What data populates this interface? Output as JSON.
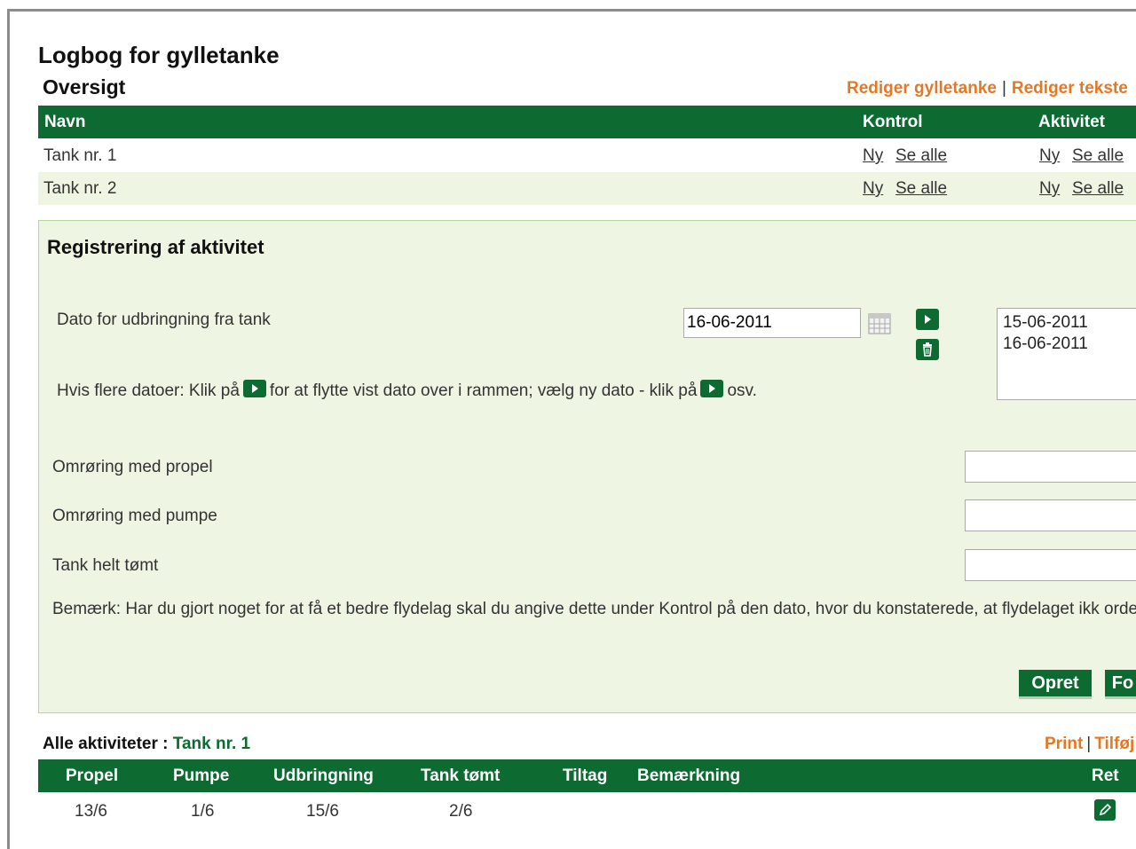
{
  "page": {
    "title": "Logbog for gylletanke"
  },
  "overview": {
    "title": "Oversigt",
    "links": {
      "edit_tanks": "Rediger gylletanke",
      "separator": "|",
      "edit_texts": "Rediger tekste"
    },
    "columns": {
      "name": "Navn",
      "control": "Kontrol",
      "activity": "Aktivitet"
    },
    "rows": [
      {
        "name": "Tank nr. 1",
        "new": "Ny",
        "see_all": "Se alle"
      },
      {
        "name": "Tank nr. 2",
        "new": "Ny",
        "see_all": "Se alle"
      }
    ]
  },
  "registration": {
    "title": "Registrering af aktivitet",
    "date_label": "Dato for udbringning fra tank",
    "date_value": "16-06-2011",
    "dates": [
      "15-06-2011",
      "16-06-2011"
    ],
    "hint_part1": "Hvis flere datoer: Klik på",
    "hint_part2": "for at flytte vist dato over i rammen; vælg ny dato - klik på",
    "hint_part3": "osv.",
    "field_propel": "Omrøring med propel",
    "field_pump": "Omrøring med pumpe",
    "field_empty": "Tank helt tømt",
    "note": "Bemærk: Har du gjort noget for at få et bedre flydelag skal du angive dette under Kontrol på den dato, hvor du konstaterede, at flydelaget ikk orden",
    "buttons": {
      "create": "Opret",
      "next": "Fo"
    }
  },
  "activities": {
    "label": "Alle aktiviteter :",
    "tank": "Tank nr. 1",
    "links": {
      "print": "Print",
      "separator": "|",
      "add": "Tilføj"
    },
    "columns": {
      "propel": "Propel",
      "pump": "Pumpe",
      "spread": "Udbringning",
      "emptied": "Tank tømt",
      "measure": "Tiltag",
      "remark": "Bemærkning",
      "edit": "Ret"
    },
    "rows": [
      {
        "propel": "13/6",
        "pump": "1/6",
        "spread": "15/6",
        "emptied": "2/6",
        "measure": "",
        "remark": ""
      }
    ]
  },
  "colors": {
    "header_green": "#0d6b32",
    "link_orange": "#e87722",
    "panel_bg": "#eef5e3",
    "row_alt": "#eef5e3"
  }
}
